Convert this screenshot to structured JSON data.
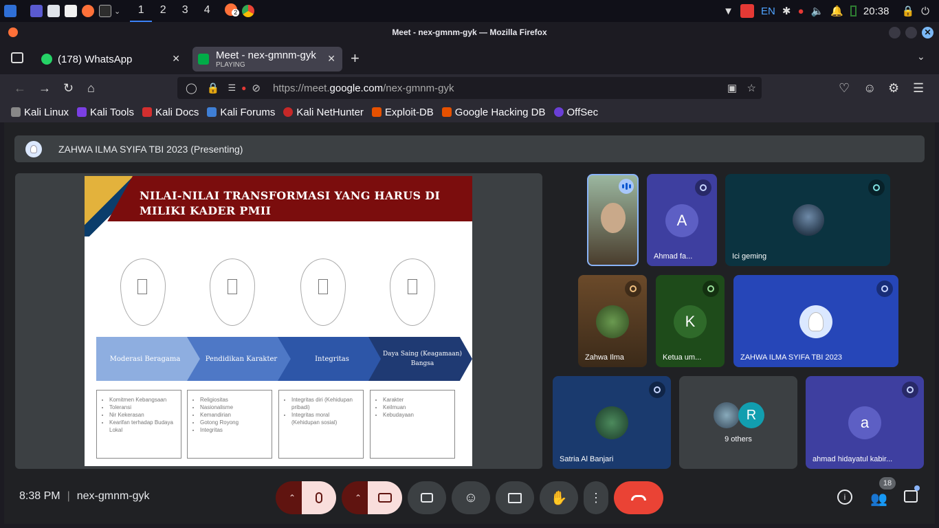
{
  "taskbar": {
    "workspaces": [
      "1",
      "2",
      "3",
      "4"
    ],
    "active_workspace": "1",
    "lang": "EN",
    "clock": "20:38",
    "badge": "2"
  },
  "window": {
    "title": "Meet - nex-gmnm-gyk — Mozilla Firefox"
  },
  "tabs": [
    {
      "label": "(178) WhatsApp",
      "sub": ""
    },
    {
      "label": "Meet - nex-gmnm-gyk",
      "sub": "PLAYING"
    }
  ],
  "nav": {
    "url_prefix": "https://meet.",
    "url_domain": "google.com",
    "url_path": "/nex-gmnm-gyk"
  },
  "bookmarks": [
    "Kali Linux",
    "Kali Tools",
    "Kali Docs",
    "Kali Forums",
    "Kali NetHunter",
    "Exploit-DB",
    "Google Hacking DB",
    "OffSec"
  ],
  "meet": {
    "presenter": "ZAHWA ILMA SYIFA TBI 2023 (Presenting)",
    "slide": {
      "title": "NILAI-NILAI TRANSFORMASI YANG HARUS DI MILIKI KADER PMII",
      "steps": [
        "Moderasi Beragama",
        "Pendidikan Karakter",
        "Integritas",
        "Daya Saing (Keagamaan) Bangsa"
      ],
      "lists": [
        [
          "Komitmen Kebangsaan",
          "Toleransi",
          "Nir Kekerasan",
          "Kearifan terhadap Budaya Lokal"
        ],
        [
          "Religiositas",
          "Nasionalisme",
          "Kemandirian",
          "Gotong Royong",
          "Integritas"
        ],
        [
          "Integritas diri (Kehidupan pribadi)",
          "Integritas moral (Kehidupan sosial)"
        ],
        [
          "Karakter",
          "Keilmuan",
          "Kebudayaan"
        ]
      ]
    },
    "participants": [
      {
        "name": "",
        "initial": ""
      },
      {
        "name": "Ahmad fa...",
        "initial": "A"
      },
      {
        "name": "Ici geming",
        "initial": ""
      },
      {
        "name": "Zahwa Ilma",
        "initial": ""
      },
      {
        "name": "Ketua um...",
        "initial": "K"
      },
      {
        "name": "ZAHWA ILMA SYIFA TBI 2023",
        "initial": ""
      },
      {
        "name": "Satria Al Banjari",
        "initial": ""
      },
      {
        "name": "9 others",
        "initial": "R"
      },
      {
        "name": "ahmad hidayatul kabir...",
        "initial": "a"
      }
    ],
    "time": "8:38 PM",
    "separator": "|",
    "meeting_code": "nex-gmnm-gyk",
    "people_count": "18"
  },
  "colors": {
    "accent": "#8ab4f8",
    "end_call": "#ea4335",
    "muted_bg": "#f9dedc",
    "muted_dark": "#601410"
  }
}
